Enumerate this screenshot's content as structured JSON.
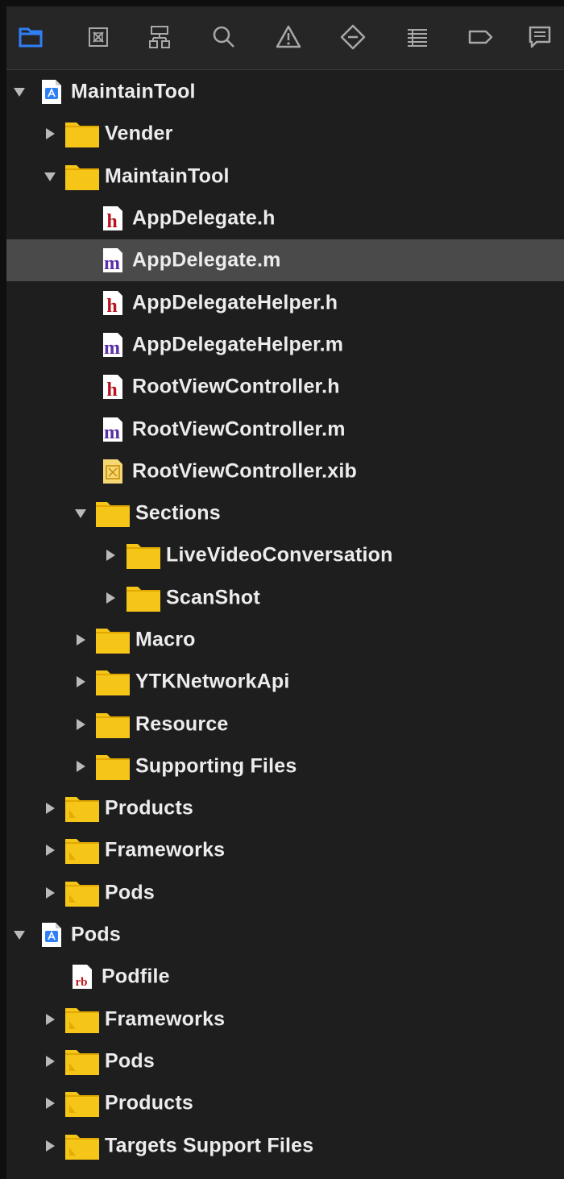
{
  "colors": {
    "accent": "#2f7ff7",
    "folder": "#f5c518",
    "folder_dark": "#e0a800",
    "header_file": "#b8131f",
    "impl_file": "#5b2fa8",
    "selection": "#4a4a4a"
  },
  "toolbar": {
    "buttons": [
      {
        "icon": "folder-navigator-icon"
      },
      {
        "icon": "source-control-icon"
      },
      {
        "icon": "symbol-navigator-icon"
      },
      {
        "icon": "search-icon"
      },
      {
        "icon": "warning-icon"
      },
      {
        "icon": "test-diamond-icon"
      },
      {
        "icon": "debug-list-icon"
      },
      {
        "icon": "breakpoint-tag-icon"
      },
      {
        "icon": "report-bubble-icon"
      }
    ]
  },
  "tree": {
    "rows": [
      {
        "label": "MaintainTool",
        "depth": 0,
        "kind": "project",
        "disclosure": "open"
      },
      {
        "label": "Vender",
        "depth": 1,
        "kind": "folder",
        "disclosure": "closed"
      },
      {
        "label": "MaintainTool",
        "depth": 1,
        "kind": "folder",
        "disclosure": "open"
      },
      {
        "label": "AppDelegate.h",
        "depth": 2,
        "kind": "h",
        "disclosure": "none"
      },
      {
        "label": "AppDelegate.m",
        "depth": 2,
        "kind": "m",
        "disclosure": "none",
        "selected": true
      },
      {
        "label": "AppDelegateHelper.h",
        "depth": 2,
        "kind": "h",
        "disclosure": "none"
      },
      {
        "label": "AppDelegateHelper.m",
        "depth": 2,
        "kind": "m",
        "disclosure": "none"
      },
      {
        "label": "RootViewController.h",
        "depth": 2,
        "kind": "h",
        "disclosure": "none"
      },
      {
        "label": "RootViewController.m",
        "depth": 2,
        "kind": "m",
        "disclosure": "none"
      },
      {
        "label": "RootViewController.xib",
        "depth": 2,
        "kind": "xib",
        "disclosure": "none"
      },
      {
        "label": "Sections",
        "depth": 2,
        "kind": "folder",
        "disclosure": "open"
      },
      {
        "label": "LiveVideoConversation",
        "depth": 3,
        "kind": "folder",
        "disclosure": "closed"
      },
      {
        "label": "ScanShot",
        "depth": 3,
        "kind": "folder",
        "disclosure": "closed"
      },
      {
        "label": "Macro",
        "depth": 2,
        "kind": "folder",
        "disclosure": "closed"
      },
      {
        "label": "YTKNetworkApi",
        "depth": 2,
        "kind": "folder",
        "disclosure": "closed"
      },
      {
        "label": "Resource",
        "depth": 2,
        "kind": "folder",
        "disclosure": "closed"
      },
      {
        "label": "Supporting Files",
        "depth": 2,
        "kind": "folder",
        "disclosure": "closed"
      },
      {
        "label": "Products",
        "depth": 1,
        "kind": "group-folder",
        "disclosure": "closed"
      },
      {
        "label": "Frameworks",
        "depth": 1,
        "kind": "group-folder",
        "disclosure": "closed"
      },
      {
        "label": "Pods",
        "depth": 1,
        "kind": "group-folder",
        "disclosure": "closed"
      },
      {
        "label": "Pods",
        "depth": 0,
        "kind": "project",
        "disclosure": "open"
      },
      {
        "label": "Podfile",
        "depth": 1,
        "kind": "rb",
        "disclosure": "none"
      },
      {
        "label": "Frameworks",
        "depth": 1,
        "kind": "group-folder",
        "disclosure": "closed"
      },
      {
        "label": "Pods",
        "depth": 1,
        "kind": "group-folder",
        "disclosure": "closed"
      },
      {
        "label": "Products",
        "depth": 1,
        "kind": "group-folder",
        "disclosure": "closed"
      },
      {
        "label": "Targets Support Files",
        "depth": 1,
        "kind": "group-folder",
        "disclosure": "closed"
      }
    ]
  }
}
